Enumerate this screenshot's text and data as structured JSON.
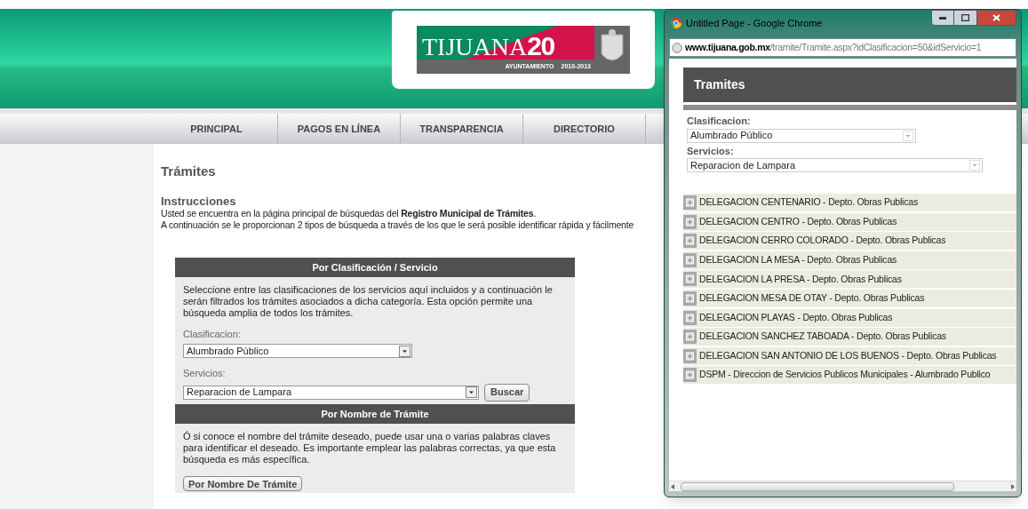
{
  "site": {
    "logo": {
      "name": "TIJUANA",
      "number": "20",
      "subtitle": "AYUNTAMIENTO",
      "years": "2010-2013"
    },
    "nav": [
      {
        "label": "PRINCIPAL"
      },
      {
        "label": "PAGOS EN LÍNEA"
      },
      {
        "label": "TRANSPARENCIA"
      },
      {
        "label": "DIRECTORIO"
      }
    ],
    "page_title": "Trámites",
    "instructions": {
      "heading": "Instrucciones",
      "lines": [
        "Usted se encuentra en la página principal de búsquedas del **Registro Municipal de Trámites**.",
        "A continuación se le proporcionan 2 tipos de búsqueda a través de los que le será posible identificar rápida y fácilmente"
      ]
    },
    "panel_classification": {
      "title": "Por Clasificación / Servicio",
      "description": "Seleccione entre las clasificaciones de los servicios aquí incluidos y a continuación le serán filtrados los trámites asociados a dicha categoría. Esta opción permite una búsqueda amplia de todos los trámites.",
      "fields": [
        {
          "label": "Clasificacion:",
          "value": "Alumbrado Público"
        },
        {
          "label": "Servicios:",
          "value": "Reparacion de Lampara"
        }
      ],
      "button": "Buscar"
    },
    "panel_name": {
      "title": "Por Nombre de Trámite",
      "description": "Ó si conoce el nombre del trámite deseado, puede usar una o varias palabras claves para identificar el deseado. Es importante emplear las palabras correctas, ya que esta búsqueda es más específica.",
      "button": "Por Nombre De Trámite"
    }
  },
  "popup": {
    "title": "Untitled Page - Google Chrome",
    "url_host": "www.tijuana.gob.mx",
    "url_path": "/tramite/Tramite.aspx?idClasificacion=50&idServicio=1",
    "heading": "Tramites",
    "fields": [
      {
        "label": "Clasificacion:",
        "value": "Alumbrado Público"
      },
      {
        "label": "Servicios:",
        "value": "Reparacion de Lampara"
      }
    ],
    "results": [
      {
        "label": "DELEGACION CENTENARIO - Depto. Obras Publicas",
        "expanded": false
      },
      {
        "label": "DELEGACION CENTRO - Depto. Obras Publicas",
        "expanded": false
      },
      {
        "label": "DELEGACION CERRO COLORADO - Depto. Obras Publicas",
        "expanded": false
      },
      {
        "label": "DELEGACION LA MESA - Depto. Obras Publicas",
        "expanded": false
      },
      {
        "label": "DELEGACION LA PRESA - Depto. Obras Publicas",
        "expanded": false
      },
      {
        "label": "DELEGACION MESA DE OTAY - Depto. Obras Publicas",
        "expanded": false
      },
      {
        "label": "DELEGACION PLAYAS - Depto. Obras Publicas",
        "expanded": false
      },
      {
        "label": "DELEGACION SANCHEZ TABOADA - Depto. Obras Publicas",
        "expanded": false
      },
      {
        "label": "DELEGACION SAN ANTONIO DE LOS BUENOS - Depto. Obras Publicas",
        "expanded": false
      },
      {
        "label": "DSPM - Direccion de Servicios Publicos Municipales - Alumbrado Publico",
        "expanded": false
      }
    ]
  }
}
